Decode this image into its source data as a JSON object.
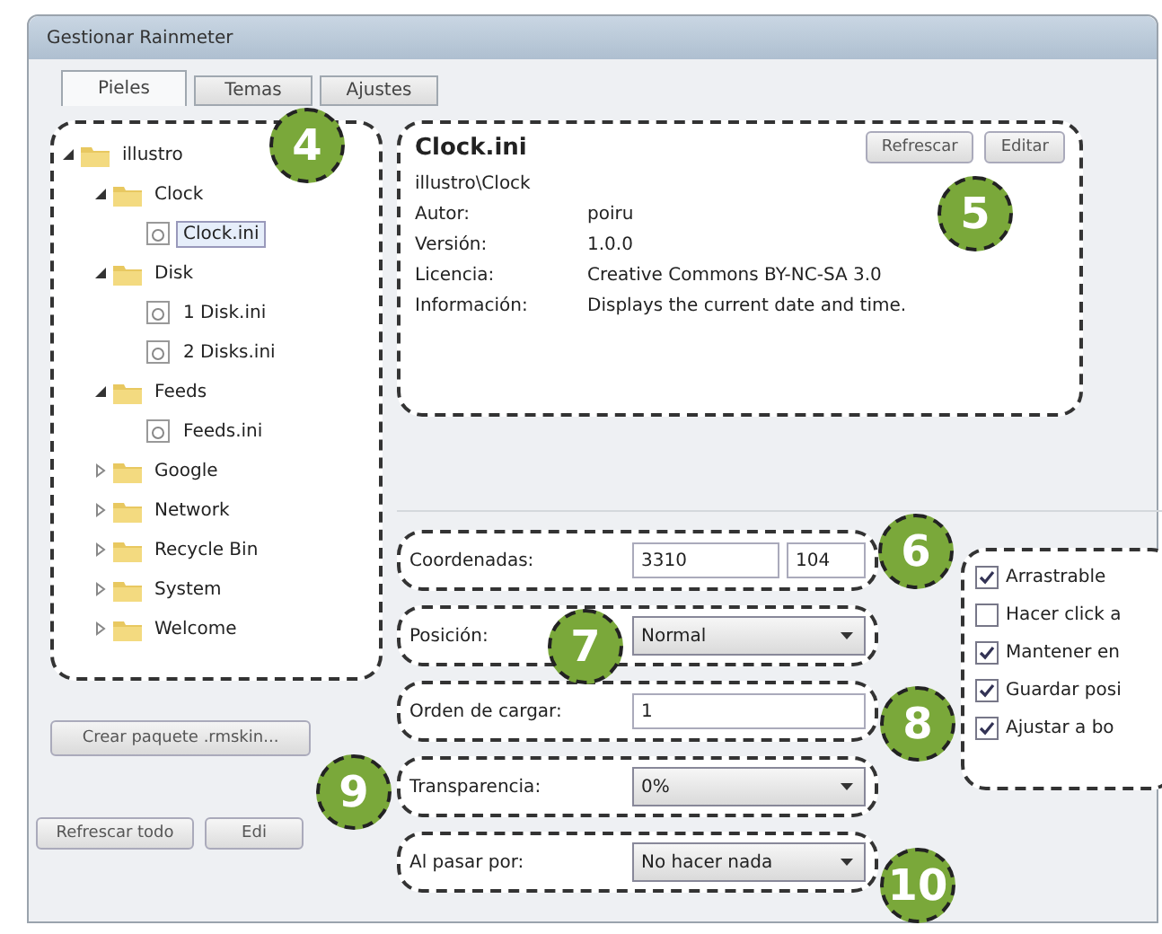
{
  "window": {
    "title": "Gestionar Rainmeter"
  },
  "tabs": [
    {
      "label": "Pieles",
      "selected": true
    },
    {
      "label": "Temas",
      "selected": false
    },
    {
      "label": "Ajustes",
      "selected": false
    }
  ],
  "tree": [
    {
      "label": "illustro",
      "kind": "folder",
      "expanded": true,
      "selected": false,
      "children": [
        {
          "label": "Clock",
          "kind": "folder",
          "expanded": true,
          "selected": false,
          "children": [
            {
              "label": "Clock.ini",
              "kind": "file",
              "selected": true
            }
          ]
        },
        {
          "label": "Disk",
          "kind": "folder",
          "expanded": true,
          "selected": false,
          "children": [
            {
              "label": "1 Disk.ini",
              "kind": "file",
              "selected": false
            },
            {
              "label": "2 Disks.ini",
              "kind": "file",
              "selected": false
            }
          ]
        },
        {
          "label": "Feeds",
          "kind": "folder",
          "expanded": true,
          "selected": false,
          "children": [
            {
              "label": "Feeds.ini",
              "kind": "file",
              "selected": false
            }
          ]
        },
        {
          "label": "Google",
          "kind": "folder",
          "expanded": false,
          "selected": false
        },
        {
          "label": "Network",
          "kind": "folder",
          "expanded": false,
          "selected": false
        },
        {
          "label": "Recycle Bin",
          "kind": "folder",
          "expanded": false,
          "selected": false
        },
        {
          "label": "System",
          "kind": "folder",
          "expanded": false,
          "selected": false
        },
        {
          "label": "Welcome",
          "kind": "folder",
          "expanded": false,
          "selected": false
        }
      ]
    }
  ],
  "skin_info": {
    "title": "Clock.ini",
    "path": "illustro\\Clock",
    "fields": [
      {
        "label": "Autor:",
        "value": "poiru"
      },
      {
        "label": "Versión:",
        "value": "1.0.0"
      },
      {
        "label": "Licencia:",
        "value": "Creative Commons BY-NC-SA 3.0"
      },
      {
        "label": "Información:",
        "value": "Displays the current date and time."
      }
    ]
  },
  "actions": [
    "Refrescar",
    "Editar"
  ],
  "settings": [
    {
      "kind": "pair",
      "label": "Coordenadas:",
      "values": [
        "3310",
        "104"
      ]
    },
    {
      "kind": "select",
      "label": "Posición:",
      "value": "Normal"
    },
    {
      "kind": "input",
      "label": "Orden de cargar:",
      "value": "1"
    },
    {
      "kind": "select",
      "label": "Transparencia:",
      "value": "0%"
    },
    {
      "kind": "select",
      "label": "Al pasar por:",
      "value": "No hacer nada"
    }
  ],
  "options": [
    {
      "label": "Arrastrable",
      "checked": true
    },
    {
      "label": "Hacer click a",
      "checked": false
    },
    {
      "label": "Mantener en",
      "checked": true
    },
    {
      "label": "Guardar posi",
      "checked": true
    },
    {
      "label": "Ajustar a bo",
      "checked": true
    }
  ],
  "package_button": "Crear paquete .rmskin...",
  "footer_buttons": [
    "Refrescar todo",
    "Edi"
  ],
  "callouts": [
    "4",
    "5",
    "6",
    "7",
    "8",
    "9",
    "10"
  ]
}
